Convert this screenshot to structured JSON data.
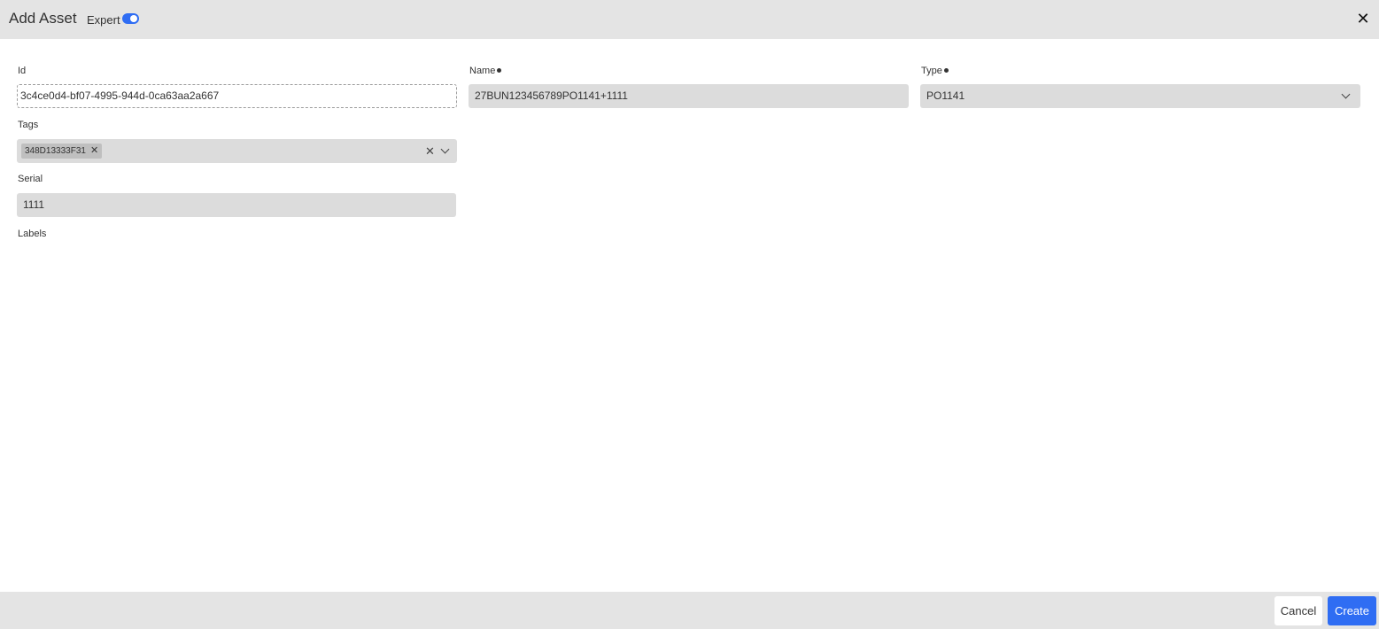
{
  "header": {
    "title": "Add Asset",
    "expert_label": "Expert",
    "expert_enabled": true,
    "close_symbol": "✕"
  },
  "form": {
    "id": {
      "label": "Id",
      "value": "3c4ce0d4-bf07-4995-944d-0ca63aa2a667"
    },
    "name": {
      "label": "Name",
      "required": true,
      "value": "27BUN123456789PO1141+1111"
    },
    "type": {
      "label": "Type",
      "required": true,
      "value": "PO1141"
    },
    "tags": {
      "label": "Tags",
      "chips": [
        "348D13333F31"
      ]
    },
    "serial": {
      "label": "Serial",
      "value": "1111"
    },
    "labels": {
      "label": "Labels"
    }
  },
  "footer": {
    "cancel_label": "Cancel",
    "create_label": "Create"
  },
  "colors": {
    "accent": "#2f6df3",
    "header_bg": "#e4e4e4",
    "field_bg": "#dcdcdc"
  },
  "icons": [
    "close-icon",
    "chevron-down-icon",
    "chip-remove-icon",
    "clear-icon"
  ]
}
